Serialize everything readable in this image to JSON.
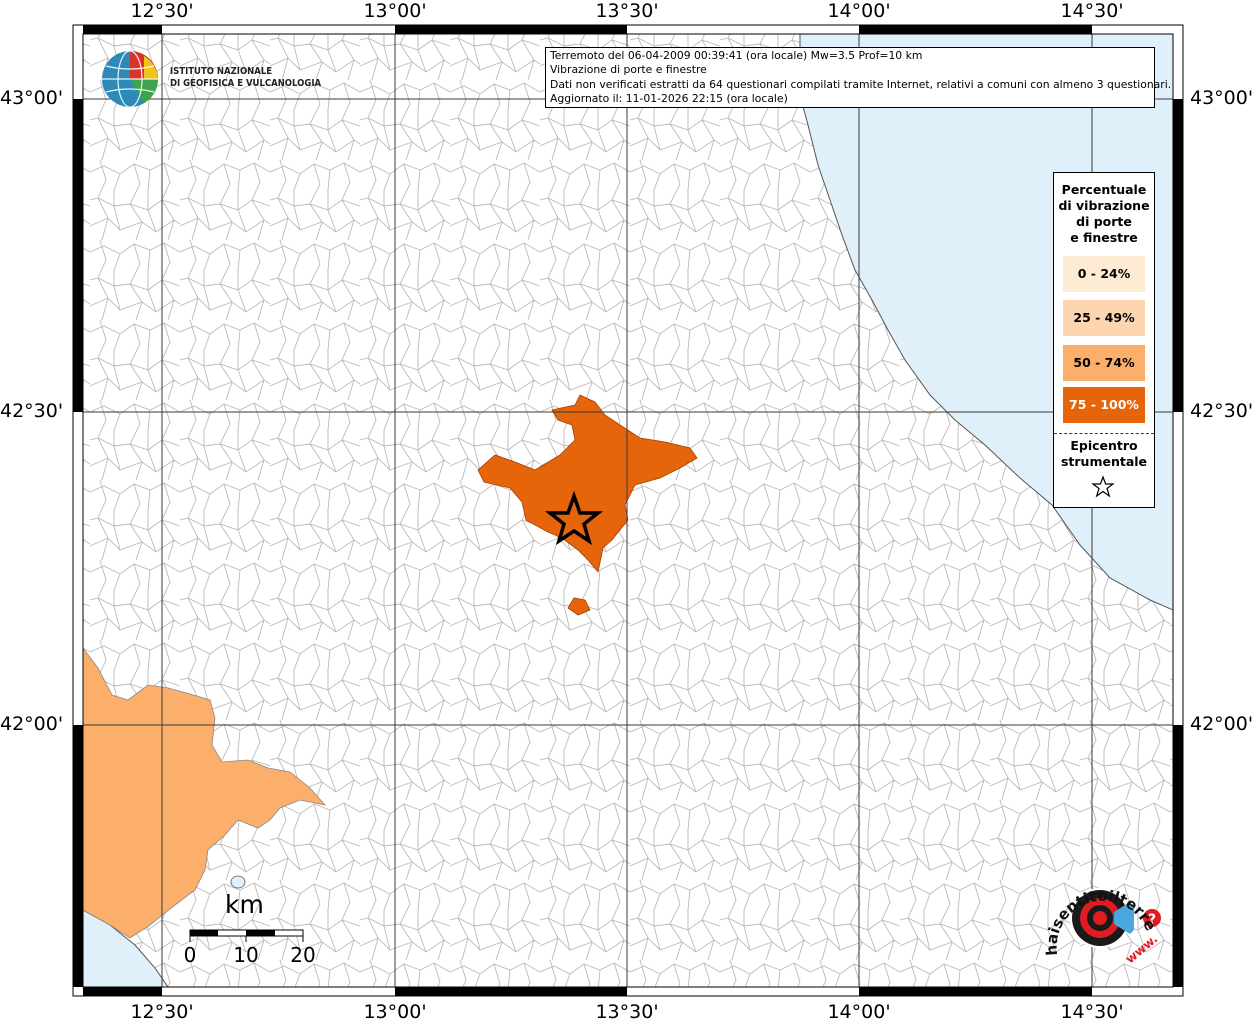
{
  "map": {
    "ticks_lon": [
      "12°30'",
      "13°00'",
      "13°30'",
      "14°00'",
      "14°30'"
    ],
    "ticks_lat": [
      "43°00'",
      "42°30'",
      "42°00'"
    ]
  },
  "logo": {
    "line1": "ISTITUTO NAZIONALE",
    "line2": "DI GEOFISICA E VULCANOLOGIA"
  },
  "info": {
    "line1": "Terremoto del 06-04-2009 00:39:41 (ora locale) Mw=3.5 Prof=10 km",
    "line2": "Vibrazione di porte e finestre",
    "line3": "Dati non verificati estratti da 64 questionari compilati tramite Internet, relativi a comuni con almeno 3 questionari.",
    "line4": "Aggiornato il: 11-01-2026 22:15 (ora locale)"
  },
  "legend": {
    "title_lines": [
      "Percentuale",
      "di vibrazione",
      "di porte",
      "e finestre"
    ],
    "classes": [
      {
        "label": "0 - 24%",
        "color": "#fdebd3",
        "text_color": "#000000"
      },
      {
        "label": "25 - 49%",
        "color": "#fdd6b0",
        "text_color": "#000000"
      },
      {
        "label": "50 - 74%",
        "color": "#fcae6b",
        "text_color": "#000000"
      },
      {
        "label": "75 - 100%",
        "color": "#e6640a",
        "text_color": "#ffffff"
      }
    ],
    "epicenter_lines": [
      "Epicentro",
      "strumentale"
    ]
  },
  "scalebar": {
    "unit": "km",
    "labels": [
      "0",
      "10",
      "20"
    ]
  },
  "badge": {
    "text": "haisentitoilterremoto.it",
    "prefix": "www.",
    "question": "?"
  },
  "colors": {
    "sea": "#e0f0fb",
    "high": "#e6640a",
    "mid": "#fcae6b",
    "border": "#b4b4b4",
    "grid": "#3a3a3a"
  }
}
